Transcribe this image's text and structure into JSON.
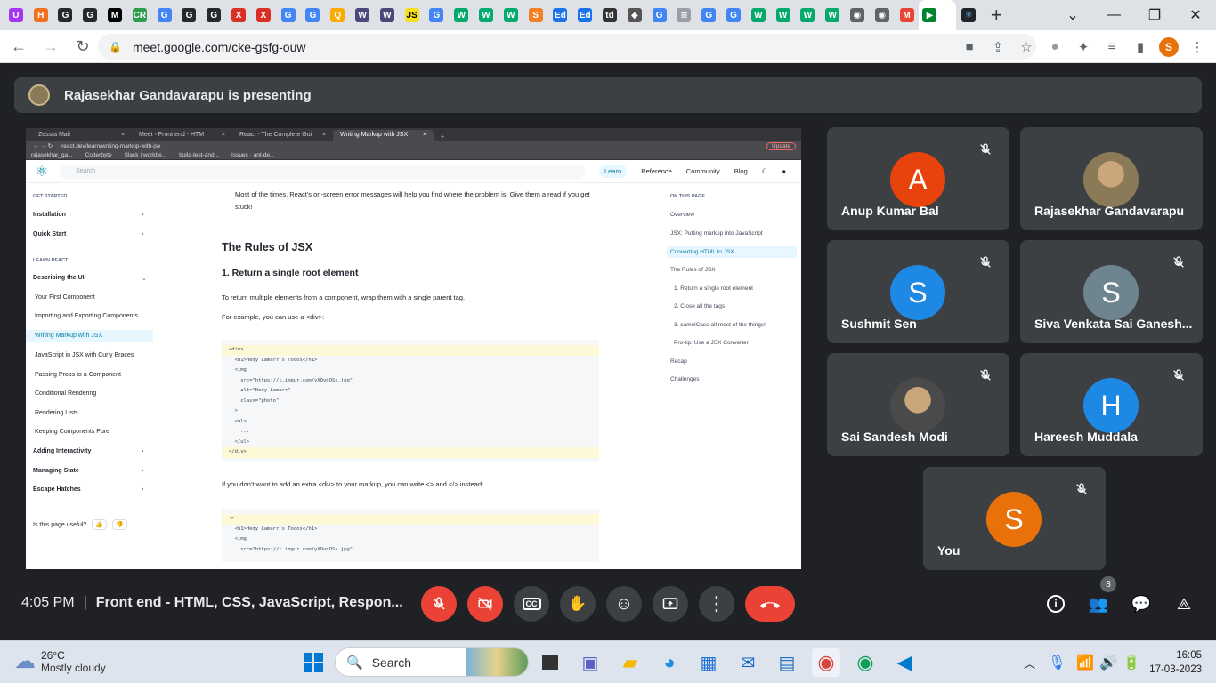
{
  "browser": {
    "tab_favicons": [
      {
        "icon": "udemy-icon",
        "color": "#a435f0",
        "glyph": "U"
      },
      {
        "icon": "hackerrank-icon",
        "color": "#f2711c",
        "glyph": "H"
      },
      {
        "icon": "github-icon",
        "color": "#24292e",
        "glyph": "G"
      },
      {
        "icon": "github-icon",
        "color": "#24292e",
        "glyph": "G"
      },
      {
        "icon": "medium-icon",
        "color": "#000000",
        "glyph": "M"
      },
      {
        "icon": "cr-icon",
        "color": "#2e9c4f",
        "glyph": "CR"
      },
      {
        "icon": "google-icon",
        "color": "#4285f4",
        "glyph": "G"
      },
      {
        "icon": "github-icon",
        "color": "#24292e",
        "glyph": "G"
      },
      {
        "icon": "github-icon",
        "color": "#24292e",
        "glyph": "G"
      },
      {
        "icon": "toolkit-icon",
        "color": "#d93025",
        "glyph": "X"
      },
      {
        "icon": "toolkit-icon",
        "color": "#d93025",
        "glyph": "X"
      },
      {
        "icon": "google-icon",
        "color": "#4285f4",
        "glyph": "G"
      },
      {
        "icon": "google-icon",
        "color": "#4285f4",
        "glyph": "G"
      },
      {
        "icon": "search-icon",
        "color": "#f9ab00",
        "glyph": "Q"
      },
      {
        "icon": "w3-icon",
        "color": "#4a4a7a",
        "glyph": "W"
      },
      {
        "icon": "w3-icon",
        "color": "#4a4a7a",
        "glyph": "W"
      },
      {
        "icon": "js-icon",
        "color": "#f7df1e",
        "glyph": "JS"
      },
      {
        "icon": "google-icon",
        "color": "#4285f4",
        "glyph": "G"
      },
      {
        "icon": "w3schools-icon",
        "color": "#04aa6d",
        "glyph": "W"
      },
      {
        "icon": "w3schools-icon",
        "color": "#04aa6d",
        "glyph": "W"
      },
      {
        "icon": "w3schools-icon",
        "color": "#04aa6d",
        "glyph": "W"
      },
      {
        "icon": "stackoverflow-icon",
        "color": "#f48024",
        "glyph": "S"
      },
      {
        "icon": "edureka-icon",
        "color": "#1a73e8",
        "glyph": "Ed"
      },
      {
        "icon": "edureka-icon",
        "color": "#1a73e8",
        "glyph": "Ed"
      },
      {
        "icon": "td-icon",
        "color": "#333333",
        "glyph": "td"
      },
      {
        "icon": "diamond-icon",
        "color": "#555555",
        "glyph": "◆"
      },
      {
        "icon": "google-icon",
        "color": "#4285f4",
        "glyph": "G"
      },
      {
        "icon": "layers-icon",
        "color": "#9aa0a6",
        "glyph": "≋"
      },
      {
        "icon": "google-icon",
        "color": "#4285f4",
        "glyph": "G"
      },
      {
        "icon": "google-icon",
        "color": "#4285f4",
        "glyph": "G"
      },
      {
        "icon": "w3schools-icon",
        "color": "#04aa6d",
        "glyph": "W"
      },
      {
        "icon": "w3schools-icon",
        "color": "#04aa6d",
        "glyph": "W"
      },
      {
        "icon": "w3schools-icon",
        "color": "#04aa6d",
        "glyph": "W"
      },
      {
        "icon": "w3schools-icon",
        "color": "#04aa6d",
        "glyph": "W"
      },
      {
        "icon": "globe-icon",
        "color": "#5f6368",
        "glyph": "◉"
      },
      {
        "icon": "globe-icon",
        "color": "#5f6368",
        "glyph": "◉"
      },
      {
        "icon": "gmail-icon",
        "color": "#ea4335",
        "glyph": "M"
      }
    ],
    "active_tab_icon": "meet-icon",
    "url": "meet.google.com/cke-gsfg-ouw",
    "profile_initial": "S"
  },
  "meet": {
    "presenter_banner": "Rajasekhar Gandavarapu is presenting",
    "time": "4:05 PM",
    "meeting_name": "Front end - HTML, CSS, JavaScript, Respon...",
    "participant_count": "8",
    "participants": [
      {
        "name": "Anup Kumar Bal",
        "initial": "A",
        "color": "#e8430c",
        "photo": false
      },
      {
        "name": "Rajasekhar Gandavarapu",
        "initial": "R",
        "color": "#8a7a58",
        "photo": true
      },
      {
        "name": "Sushmit Sen",
        "initial": "S",
        "color": "#1e88e5",
        "photo": false
      },
      {
        "name": "Siva Venkata Sai Ganesh...",
        "initial": "S",
        "color": "#6e8590",
        "photo": false
      },
      {
        "name": "Sai Sandesh Modi",
        "initial": "S",
        "color": "#4a4a4a",
        "photo": true
      },
      {
        "name": "Hareesh Muddala",
        "initial": "H",
        "color": "#1e88e5",
        "photo": false
      },
      {
        "name": "You",
        "initial": "S",
        "color": "#e8710a",
        "photo": false
      }
    ]
  },
  "shared": {
    "tabs": [
      "Zessta Mail",
      "Meet - Front end - HTM",
      "React - The Complete Gui",
      "Writing Markup with JSX"
    ],
    "url": "react.dev/learn/writing-markup-with-jsx",
    "update_label": "Update",
    "bookmarks": [
      "rajasekhar_ga...",
      "Coderbyte",
      "Slack | workbe...",
      "build-test-and...",
      "Issues · ant-de..."
    ],
    "search_placeholder": "Search",
    "nav": [
      "Learn",
      "Reference",
      "Community",
      "Blog"
    ],
    "sidebar": {
      "get_started": "GET STARTED",
      "installation": "Installation",
      "quick_start": "Quick Start",
      "learn_react": "LEARN REACT",
      "describing_ui": "Describing the UI",
      "items": [
        "Your First Component",
        "Importing and Exporting Components",
        "Writing Markup with JSX",
        "JavaScript in JSX with Curly Braces",
        "Passing Props to a Component",
        "Conditional Rendering",
        "Rendering Lists",
        "Keeping Components Pure"
      ],
      "adding_interactivity": "Adding Interactivity",
      "managing_state": "Managing State",
      "escape_hatches": "Escape Hatches",
      "page_useful": "Is this page useful?"
    },
    "content": {
      "note": "Most of the times, React's on-screen error messages will help you find where the problem is. Give them a read if you get stuck!",
      "h2": "The Rules of JSX",
      "h3": "1. Return a single root element",
      "p1": "To return multiple elements from a component, wrap them with a single parent tag.",
      "p2": "For example, you can use a <div>:",
      "code1": [
        "<div>",
        "  <h1>Hedy Lamarr's Todos</h1>",
        "  <img",
        "    src=\"https://i.imgur.com/yXOvdOSs.jpg\"",
        "    alt=\"Hedy Lamarr\"",
        "    class=\"photo\"",
        "  >",
        "  <ul>",
        "    ...",
        "  </ul>",
        "</div>"
      ],
      "p3": "If you don't want to add an extra <div> to your markup, you can write <> and </> instead:",
      "code2": [
        "<>",
        "  <h1>Hedy Lamarr's Todos</h1>",
        "  <img",
        "    src=\"https://i.imgur.com/yXOvdOSs.jpg\""
      ]
    },
    "toc": {
      "header": "ON THIS PAGE",
      "items": [
        "Overview",
        "JSX: Putting markup into JavaScript",
        "Converting HTML to JSX",
        "The Rules of JSX",
        "1. Return a single root element",
        "2. Close all the tags",
        "3. camelCase all most of the things!",
        "Pro-tip: Use a JSX Converter",
        "Recap",
        "Challenges"
      ]
    }
  },
  "taskbar": {
    "temperature": "26°C",
    "weather": "Mostly cloudy",
    "search_label": "Search",
    "time": "16:05",
    "date": "17-03-2023"
  }
}
